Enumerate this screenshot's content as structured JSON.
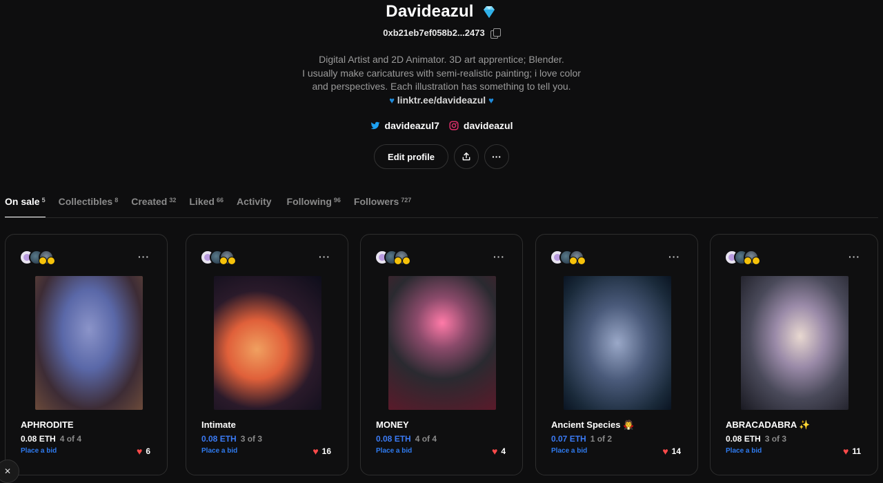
{
  "profile": {
    "name": "Davideazul",
    "badge_icon": "diamond-icon",
    "address": "0xb21eb7ef058b2...2473",
    "bio_lines": [
      "Digital Artist and 2D Animator. 3D art apprentice; Blender.",
      "I usually make caricatures with semi-realistic painting; i love color",
      "and perspectives. Each illustration has something to tell you."
    ],
    "link": "linktr.ee/davideazul",
    "twitter": "davideazul7",
    "instagram": "davideazul",
    "edit_label": "Edit profile",
    "more_label": "···"
  },
  "tabs": [
    {
      "label": "On sale",
      "count": "5"
    },
    {
      "label": "Collectibles",
      "count": "8"
    },
    {
      "label": "Created",
      "count": "32"
    },
    {
      "label": "Liked",
      "count": "66"
    },
    {
      "label": "Activity",
      "count": ""
    },
    {
      "label": "Following",
      "count": "96"
    },
    {
      "label": "Followers",
      "count": "727"
    }
  ],
  "cards": [
    {
      "title": "APHRODITE",
      "price": "0.08 ETH",
      "price_color": "#ffffff",
      "edition": "4 of 4",
      "bid": "Place a bid",
      "likes": "6",
      "more": "···"
    },
    {
      "title": "Intimate",
      "price": "0.08 ETH",
      "price_color": "#3b7bf5",
      "edition": "3 of 3",
      "bid": "Place a bid",
      "likes": "16",
      "more": "···"
    },
    {
      "title": "MONEY",
      "price": "0.08 ETH",
      "price_color": "#3b7bf5",
      "edition": "4 of 4",
      "bid": "Place a bid",
      "likes": "4",
      "more": "···"
    },
    {
      "title": "Ancient Species 🧛",
      "price": "0.07 ETH",
      "price_color": "#3b7bf5",
      "edition": "1 of 2",
      "bid": "Place a bid",
      "likes": "14",
      "more": "···"
    },
    {
      "title": "ABRACADABRA ✨",
      "price": "0.08 ETH",
      "price_color": "#ffffff",
      "edition": "3 of 3",
      "bid": "Place a bid",
      "likes": "11",
      "more": "···"
    }
  ],
  "colors": {
    "accent_blue": "#3b7bf5",
    "heart": "#ff4a4a",
    "background": "#0e0e0f"
  },
  "close_label": "✕"
}
